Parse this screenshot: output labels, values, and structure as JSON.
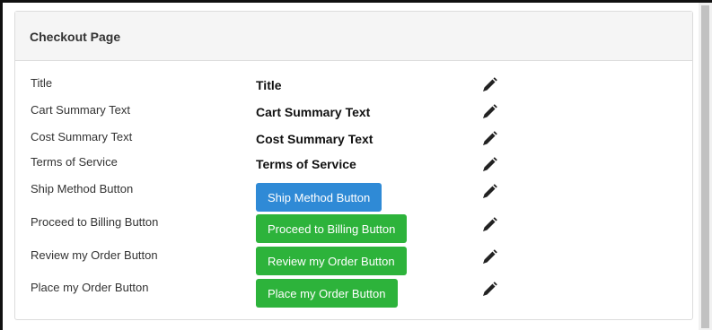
{
  "panel": {
    "title": "Checkout Page"
  },
  "rows": [
    {
      "label": "Title",
      "value": "Title",
      "kind": "text"
    },
    {
      "label": "Cart Summary Text",
      "value": "Cart Summary Text",
      "kind": "text"
    },
    {
      "label": "Cost Summary Text",
      "value": "Cost Summary Text",
      "kind": "text"
    },
    {
      "label": "Terms of Service",
      "value": "Terms of Service",
      "kind": "text"
    },
    {
      "label": "Ship Method Button",
      "value": "Ship Method Button",
      "kind": "button",
      "color": "#2f8ad6"
    },
    {
      "label": "Proceed to Billing Button",
      "value": "Proceed to Billing Button",
      "kind": "button",
      "color": "#2db33b"
    },
    {
      "label": "Review my Order Button",
      "value": "Review my Order Button",
      "kind": "button",
      "color": "#2db33b"
    },
    {
      "label": "Place my Order Button",
      "value": "Place my Order Button",
      "kind": "button",
      "color": "#2db33b"
    }
  ],
  "icons": {
    "edit": "pencil-icon"
  },
  "colors": {
    "blue_button": "#2f8ad6",
    "green_button": "#2db33b"
  }
}
